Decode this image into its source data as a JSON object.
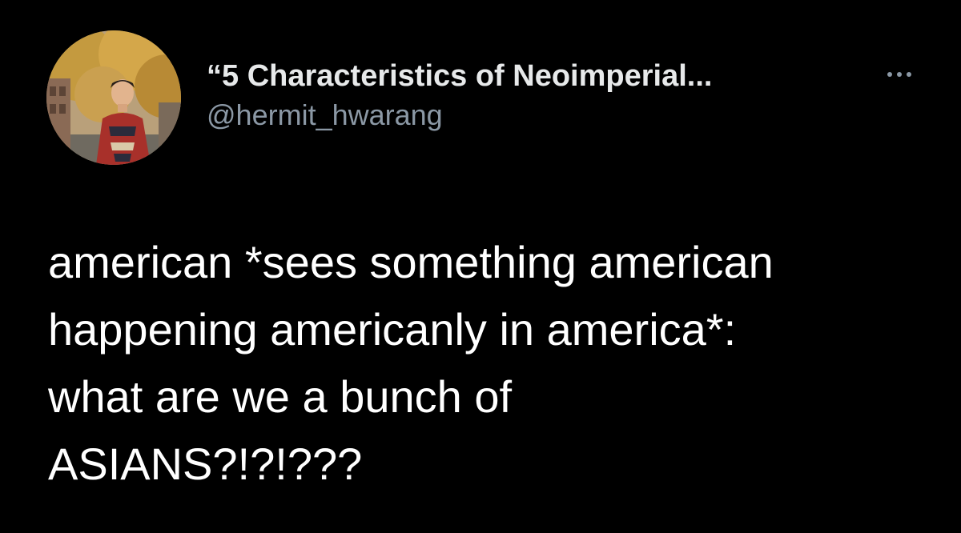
{
  "tweet": {
    "author": {
      "display_name": "“5 Characteristics of Neoimperial...",
      "handle": "@hermit_hwarang",
      "avatar_icon": "profile-photo"
    },
    "more_icon": "more-horizontal-icon",
    "text_lines": [
      "american *sees something american",
      "happening americanly in america*:",
      "what are we a bunch of",
      "ASIANS?!?!???"
    ]
  },
  "colors": {
    "background": "#000000",
    "name": "#e7e9ea",
    "handle": "#8b98a5",
    "body": "#ffffff"
  }
}
